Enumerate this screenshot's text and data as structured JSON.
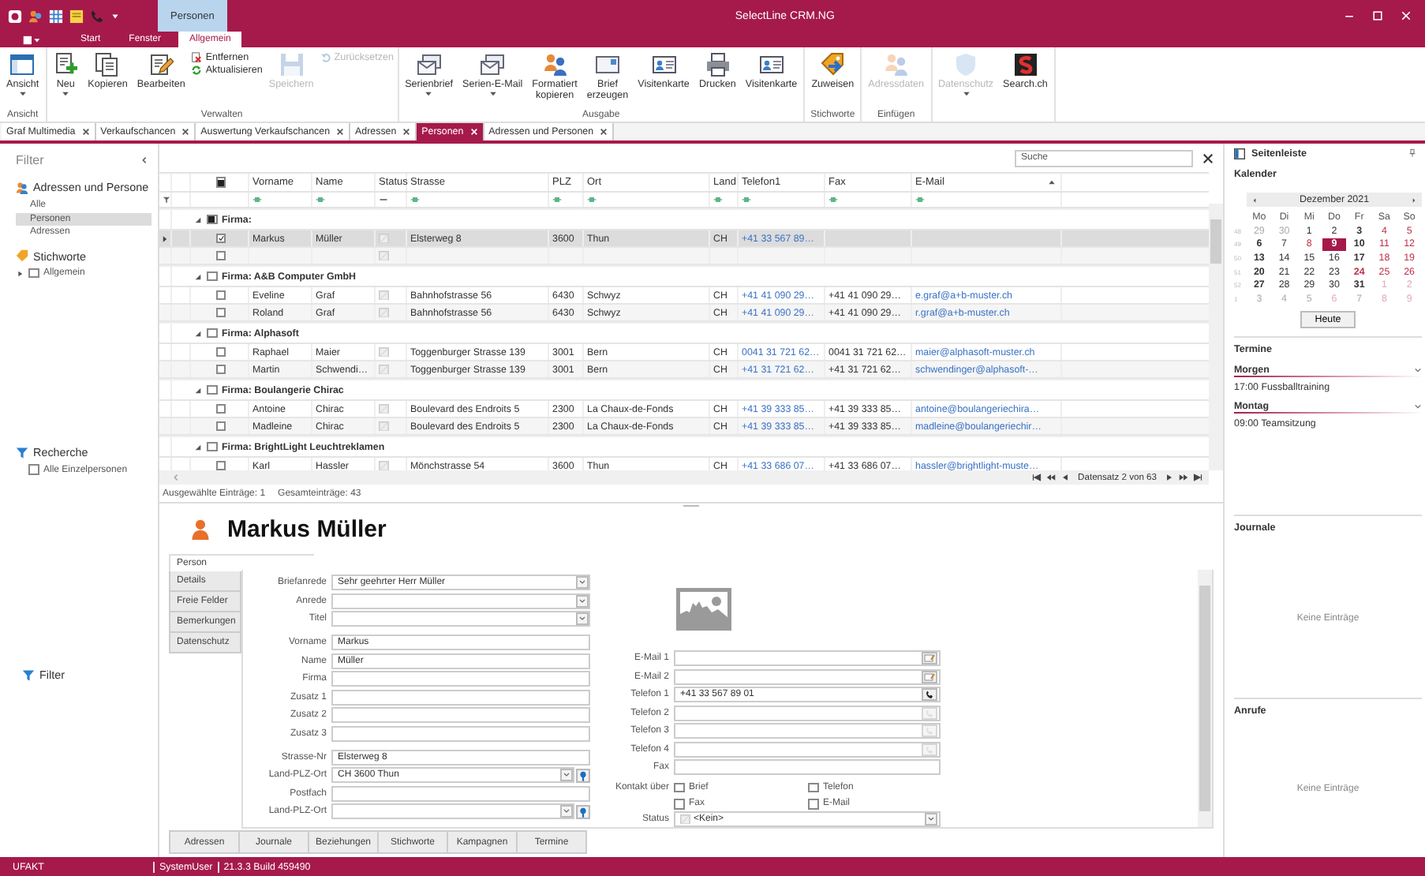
{
  "window": {
    "title": "SelectLine CRM.NG",
    "context_tab": "Personen"
  },
  "ribbon_tabs": [
    {
      "label": "Start",
      "selected": false
    },
    {
      "label": "Fenster",
      "selected": false
    },
    {
      "label": "Allgemein",
      "selected": true
    }
  ],
  "ribbon_groups": [
    {
      "label": "Ansicht",
      "buttons": [
        {
          "label": "Ansicht",
          "kind": "large",
          "dropdown": true,
          "disabled": false
        }
      ]
    },
    {
      "label": "Verwalten",
      "buttons": [
        {
          "label": "Neu",
          "kind": "large",
          "dropdown": true,
          "disabled": false
        },
        {
          "label": "Kopieren",
          "kind": "large",
          "disabled": false
        },
        {
          "label": "Bearbeiten",
          "kind": "large",
          "disabled": false
        },
        {
          "label": "Entfernen",
          "kind": "small",
          "disabled": false
        },
        {
          "label": "Aktualisieren",
          "kind": "small",
          "disabled": false
        },
        {
          "label": "Speichern",
          "kind": "large",
          "disabled": true
        },
        {
          "label": "Zurücksetzen",
          "kind": "small",
          "disabled": true
        }
      ]
    },
    {
      "label": "Ausgabe",
      "buttons": [
        {
          "label": "Serienbrief",
          "kind": "large",
          "dropdown": true,
          "disabled": false
        },
        {
          "label": "Serien-E-Mail",
          "kind": "large",
          "dropdown": true,
          "disabled": false
        },
        {
          "label": "Formatiert\nkopieren",
          "kind": "large",
          "disabled": false
        },
        {
          "label": "Brief\nerzeugen",
          "kind": "large",
          "disabled": false
        },
        {
          "label": "Visitenkarte",
          "kind": "large",
          "disabled": false
        },
        {
          "label": "Drucken",
          "kind": "large",
          "disabled": false
        },
        {
          "label": "Visitenkarte",
          "kind": "large",
          "disabled": false
        }
      ]
    },
    {
      "label": "Stichworte",
      "buttons": [
        {
          "label": "Zuweisen",
          "kind": "large",
          "disabled": false
        }
      ]
    },
    {
      "label": "Einfügen",
      "buttons": [
        {
          "label": "Adressdaten",
          "kind": "large",
          "disabled": true
        }
      ]
    },
    {
      "buttons": [
        {
          "label": "Datenschutz",
          "kind": "large",
          "dropdown": true,
          "disabled": true
        },
        {
          "label": "Search.ch",
          "kind": "large",
          "disabled": false
        }
      ]
    }
  ],
  "doc_tabs": [
    {
      "label": "Graf Multimedia",
      "selected": false
    },
    {
      "label": "Verkaufschancen",
      "selected": false
    },
    {
      "label": "Auswertung Verkaufschancen",
      "selected": false
    },
    {
      "label": "Adressen",
      "selected": false
    },
    {
      "label": "Personen",
      "selected": true
    },
    {
      "label": "Adressen und Personen",
      "selected": false
    }
  ],
  "filter_panel": {
    "title": "Filter",
    "sections": [
      {
        "title": "Adressen und Persone",
        "kind": "list",
        "items": [
          {
            "label": "Alle",
            "selected": false
          },
          {
            "label": "Personen",
            "selected": true
          },
          {
            "label": "Adressen",
            "selected": false
          }
        ]
      },
      {
        "title": "Stichworte",
        "kind": "tree",
        "items": [
          {
            "label": "Allgemein",
            "checked": false,
            "expanded": false
          }
        ]
      },
      {
        "title": "Recherche",
        "kind": "checks",
        "items": [
          {
            "label": "Alle Einzelpersonen",
            "checked": false
          }
        ]
      }
    ],
    "bottom_title": "Filter"
  },
  "grid": {
    "search": {
      "placeholder": "Suche"
    },
    "select_all": {
      "checked": false,
      "partial": true
    },
    "columns": [
      {
        "label": "Vorname",
        "kind": "text"
      },
      {
        "label": "Name",
        "kind": "text"
      },
      {
        "label": "Status",
        "kind": "status"
      },
      {
        "label": "Strasse",
        "kind": "text"
      },
      {
        "label": "PLZ",
        "kind": "text"
      },
      {
        "label": "Ort",
        "kind": "text"
      },
      {
        "label": "Land",
        "kind": "text"
      },
      {
        "label": "Telefon1",
        "kind": "link"
      },
      {
        "label": "Fax",
        "kind": "text"
      },
      {
        "label": "E-Mail",
        "kind": "link",
        "sorted": true
      }
    ],
    "groups": [
      {
        "label": "Firma:",
        "checked": false,
        "partial": true,
        "expanded": true,
        "rows": [
          {
            "checked": true,
            "selected": true,
            "cells": [
              "Markus",
              "Müller",
              "Elsterweg 8",
              "3600",
              "Thun",
              "CH",
              "+41 33 567 89…",
              null,
              null
            ]
          },
          {
            "checked": false,
            "selected": false
          }
        ]
      },
      {
        "label": "Firma: A&B Computer GmbH",
        "checked": false,
        "partial": false,
        "expanded": true,
        "rows": [
          {
            "checked": false,
            "selected": false,
            "cells": [
              "Eveline",
              "Graf",
              "Bahnhofstrasse 56",
              "6430",
              "Schwyz",
              "CH",
              "+41 41 090 29…",
              "+41 41 090 29…",
              "e.graf@a+b-muster.ch"
            ]
          },
          {
            "checked": false,
            "selected": false,
            "cells": [
              "Roland",
              "Graf",
              "Bahnhofstrasse 56",
              "6430",
              "Schwyz",
              "CH",
              "+41 41 090 29…",
              "+41 41 090 29…",
              "r.graf@a+b-muster.ch"
            ]
          }
        ]
      },
      {
        "label": "Firma: Alphasoft",
        "checked": false,
        "partial": false,
        "expanded": true,
        "rows": [
          {
            "checked": false,
            "selected": false,
            "cells": [
              "Raphael",
              "Maier",
              "Toggenburger Strasse 139",
              "3001",
              "Bern",
              "CH",
              "0041 31 721 62…",
              "0041 31 721 62…",
              "maier@alphasoft-muster.ch"
            ]
          },
          {
            "checked": false,
            "selected": false,
            "cells": [
              "Martin",
              "Schwendi…",
              "Toggenburger Strasse 139",
              "3001",
              "Bern",
              "CH",
              "+41 31 721 62…",
              "+41 31 721 62…",
              "schwendinger@alphasoft-…"
            ]
          }
        ]
      },
      {
        "label": "Firma: Boulangerie Chirac",
        "checked": false,
        "partial": false,
        "expanded": true,
        "rows": [
          {
            "checked": false,
            "selected": false,
            "cells": [
              "Antoine",
              "Chirac",
              "Boulevard des Endroits 5",
              "2300",
              "La Chaux-de-Fonds",
              "CH",
              "+41 39 333 85…",
              "+41 39 333 85…",
              "antoine@boulangeriechira…"
            ]
          },
          {
            "checked": false,
            "selected": false,
            "cells": [
              "Madleine",
              "Chirac",
              "Boulevard des Endroits 5",
              "2300",
              "La Chaux-de-Fonds",
              "CH",
              "+41 39 333 85…",
              "+41 39 333 85…",
              "madleine@boulangeriechir…"
            ]
          }
        ]
      },
      {
        "label": "Firma: BrightLight Leuchtreklamen",
        "checked": false,
        "partial": false,
        "expanded": true,
        "rows": [
          {
            "checked": false,
            "selected": false,
            "cells": [
              "Karl",
              "Hassler",
              "Mönchstrasse 54",
              "3600",
              "Thun",
              "CH",
              "+41 33 686 07…",
              "+41 33 686 07…",
              "hassler@brightlight-muste…"
            ]
          }
        ]
      }
    ],
    "navigator": "Datensatz 2 von 63",
    "selected_count": "Ausgewählte Einträge: 1",
    "total_count": "Gesamteinträge: 43"
  },
  "detail": {
    "name": "Markus Müller",
    "side_tabs": [
      {
        "label": "Person",
        "selected": true
      },
      {
        "label": "Details",
        "selected": false
      },
      {
        "label": "Freie Felder",
        "selected": false
      },
      {
        "label": "Bemerkungen",
        "selected": false
      },
      {
        "label": "Datenschutz",
        "selected": false
      }
    ],
    "field_groups": [
      [
        {
          "label": "Briefanrede",
          "kind": "select",
          "value": "Sehr geehrter Herr Müller"
        },
        {
          "label": "Anrede",
          "kind": "select"
        },
        {
          "label": "Titel",
          "kind": "select"
        }
      ],
      [
        {
          "label": "Vorname",
          "kind": "text",
          "value": "Markus"
        },
        {
          "label": "Name",
          "kind": "text",
          "value": "Müller"
        },
        {
          "label": "Firma",
          "kind": "text"
        },
        {
          "label": "Zusatz 1",
          "kind": "text"
        },
        {
          "label": "Zusatz 2",
          "kind": "text"
        },
        {
          "label": "Zusatz 3",
          "kind": "text"
        }
      ],
      [
        {
          "label": "Strasse-Nr",
          "kind": "text",
          "value": "Elsterweg 8"
        },
        {
          "label": "Land-PLZ-Ort",
          "kind": "location",
          "value": "CH 3600 Thun"
        },
        {
          "label": "Postfach",
          "kind": "text"
        },
        {
          "label": "Land-PLZ-Ort",
          "kind": "location"
        }
      ]
    ],
    "contact_fields": [
      {
        "label": "E-Mail 1",
        "kind": "email",
        "action_enabled": true
      },
      {
        "label": "E-Mail 2",
        "kind": "email",
        "action_enabled": true
      },
      {
        "label": "Telefon 1",
        "kind": "phone",
        "value": "+41 33 567 89 01",
        "action_enabled": true
      },
      {
        "label": "Telefon 2",
        "kind": "phone",
        "action_enabled": false
      },
      {
        "label": "Telefon 3",
        "kind": "phone",
        "action_enabled": false
      },
      {
        "label": "Telefon 4",
        "kind": "phone",
        "action_enabled": false
      },
      {
        "label": "Fax",
        "kind": "text"
      }
    ],
    "contact_via": {
      "label": "Kontakt über",
      "options": [
        {
          "label": "Brief",
          "checked": false
        },
        {
          "label": "Telefon",
          "checked": false
        },
        {
          "label": "Fax",
          "checked": false
        },
        {
          "label": "E-Mail",
          "checked": false
        }
      ]
    },
    "status": {
      "label": "Status",
      "value": "<Kein>"
    },
    "bottom_tabs": [
      {
        "label": "Adressen",
        "selected": false
      },
      {
        "label": "Journale",
        "selected": false
      },
      {
        "label": "Beziehungen",
        "selected": false
      },
      {
        "label": "Stichworte",
        "selected": false
      },
      {
        "label": "Kampagnen",
        "selected": false
      },
      {
        "label": "Termine",
        "selected": false
      }
    ]
  },
  "sidebar": {
    "title": "Seitenleiste",
    "calendar": {
      "title": "Kalender",
      "month": "Dezember 2021",
      "weekdays": [
        "Mo",
        "Di",
        "Mi",
        "Do",
        "Fr",
        "Sa",
        "So"
      ],
      "today_button": "Heute",
      "weeks": [
        {
          "week": "48",
          "days": [
            {
              "day": "29",
              "muted": true,
              "red": false,
              "bold": false,
              "selected": false
            },
            {
              "day": "30",
              "muted": true,
              "red": false,
              "bold": false,
              "selected": false
            },
            {
              "day": "1",
              "muted": false,
              "red": false,
              "bold": false,
              "selected": false
            },
            {
              "day": "2",
              "muted": false,
              "red": false,
              "bold": false,
              "selected": false
            },
            {
              "day": "3",
              "muted": false,
              "red": false,
              "bold": true,
              "selected": false
            },
            {
              "day": "4",
              "muted": false,
              "red": true,
              "bold": false,
              "selected": false
            },
            {
              "day": "5",
              "muted": false,
              "red": true,
              "bold": false,
              "selected": false
            }
          ]
        },
        {
          "week": "49",
          "days": [
            {
              "day": "6",
              "muted": false,
              "red": false,
              "bold": true,
              "selected": false
            },
            {
              "day": "7",
              "muted": false,
              "red": false,
              "bold": false,
              "selected": false
            },
            {
              "day": "8",
              "muted": false,
              "red": true,
              "bold": false,
              "selected": false
            },
            {
              "day": "9",
              "muted": false,
              "red": false,
              "bold": true,
              "selected": true
            },
            {
              "day": "10",
              "muted": false,
              "red": false,
              "bold": true,
              "selected": false
            },
            {
              "day": "11",
              "muted": false,
              "red": true,
              "bold": false,
              "selected": false
            },
            {
              "day": "12",
              "muted": false,
              "red": true,
              "bold": false,
              "selected": false
            }
          ]
        },
        {
          "week": "50",
          "days": [
            {
              "day": "13",
              "muted": false,
              "red": false,
              "bold": true,
              "selected": false
            },
            {
              "day": "14",
              "muted": false,
              "red": false,
              "bold": false,
              "selected": false
            },
            {
              "day": "15",
              "muted": false,
              "red": false,
              "bold": false,
              "selected": false
            },
            {
              "day": "16",
              "muted": false,
              "red": false,
              "bold": false,
              "selected": false
            },
            {
              "day": "17",
              "muted": false,
              "red": false,
              "bold": true,
              "selected": false
            },
            {
              "day": "18",
              "muted": false,
              "red": true,
              "bold": false,
              "selected": false
            },
            {
              "day": "19",
              "muted": false,
              "red": true,
              "bold": false,
              "selected": false
            }
          ]
        },
        {
          "week": "51",
          "days": [
            {
              "day": "20",
              "muted": false,
              "red": false,
              "bold": true,
              "selected": false
            },
            {
              "day": "21",
              "muted": false,
              "red": false,
              "bold": false,
              "selected": false
            },
            {
              "day": "22",
              "muted": false,
              "red": false,
              "bold": false,
              "selected": false
            },
            {
              "day": "23",
              "muted": false,
              "red": false,
              "bold": false,
              "selected": false
            },
            {
              "day": "24",
              "muted": false,
              "red": true,
              "bold": true,
              "selected": false
            },
            {
              "day": "25",
              "muted": false,
              "red": true,
              "bold": false,
              "selected": false
            },
            {
              "day": "26",
              "muted": false,
              "red": true,
              "bold": false,
              "selected": false
            }
          ]
        },
        {
          "week": "52",
          "days": [
            {
              "day": "27",
              "muted": false,
              "red": false,
              "bold": true,
              "selected": false
            },
            {
              "day": "28",
              "muted": false,
              "red": false,
              "bold": false,
              "selected": false
            },
            {
              "day": "29",
              "muted": false,
              "red": false,
              "bold": false,
              "selected": false
            },
            {
              "day": "30",
              "muted": false,
              "red": false,
              "bold": false,
              "selected": false
            },
            {
              "day": "31",
              "muted": false,
              "red": false,
              "bold": true,
              "selected": false
            },
            {
              "day": "1",
              "muted": true,
              "red": true,
              "bold": false,
              "selected": false
            },
            {
              "day": "2",
              "muted": true,
              "red": true,
              "bold": false,
              "selected": false
            }
          ]
        },
        {
          "week": "1",
          "days": [
            {
              "day": "3",
              "muted": true,
              "red": false,
              "bold": false,
              "selected": false
            },
            {
              "day": "4",
              "muted": true,
              "red": false,
              "bold": false,
              "selected": false
            },
            {
              "day": "5",
              "muted": true,
              "red": false,
              "bold": false,
              "selected": false
            },
            {
              "day": "6",
              "muted": true,
              "red": true,
              "bold": false,
              "selected": false
            },
            {
              "day": "7",
              "muted": true,
              "red": false,
              "bold": false,
              "selected": false
            },
            {
              "day": "8",
              "muted": true,
              "red": true,
              "bold": false,
              "selected": false
            },
            {
              "day": "9",
              "muted": true,
              "red": true,
              "bold": false,
              "selected": false
            }
          ]
        }
      ]
    },
    "appointments": {
      "title": "Termine",
      "groups": [
        {
          "label": "Morgen",
          "expanded": true,
          "items": [
            "17:00 Fussballtraining"
          ]
        },
        {
          "label": "Montag",
          "expanded": true,
          "items": [
            "09:00 Teamsitzung"
          ]
        }
      ]
    },
    "journals": {
      "title": "Journale",
      "empty": "Keine Einträge"
    },
    "calls": {
      "title": "Anrufe",
      "empty": "Keine Einträge"
    }
  },
  "status_bar": {
    "company": "UFAKT",
    "user": "SystemUser",
    "version": "21.3.3 Build 459490"
  }
}
